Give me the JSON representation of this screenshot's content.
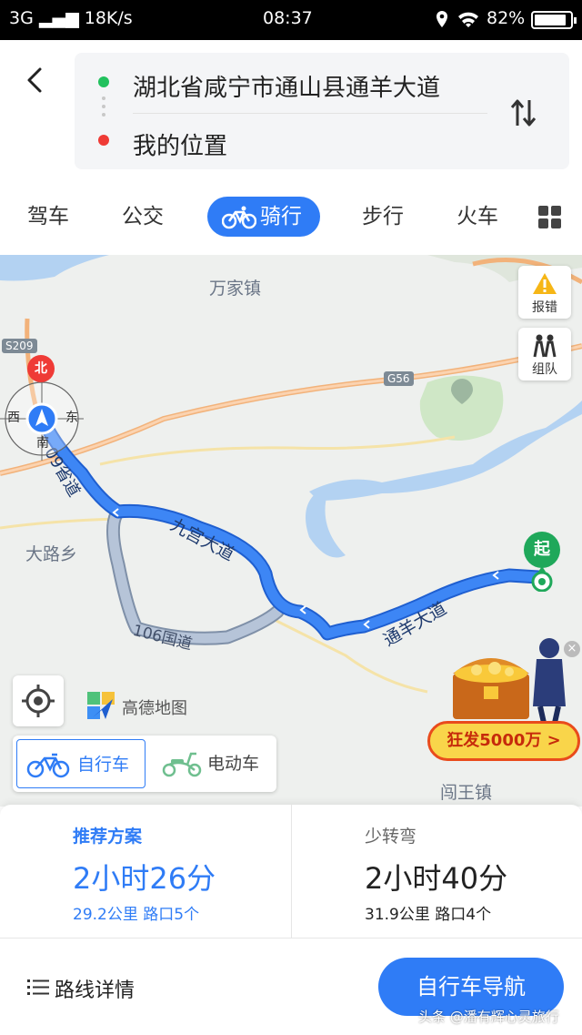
{
  "status_bar": {
    "network": "3G",
    "speed": "18K/s",
    "time": "08:37",
    "battery": "82%"
  },
  "route": {
    "start": "湖北省咸宁市通山县通羊大道",
    "end": "我的位置"
  },
  "modes": [
    {
      "label": "驾车"
    },
    {
      "label": "公交"
    },
    {
      "label": "骑行",
      "active": true
    },
    {
      "label": "步行"
    },
    {
      "label": "火车"
    }
  ],
  "map": {
    "places": [
      "万家镇",
      "大路乡",
      "闯王镇"
    ],
    "road_tags": [
      "S209",
      "G56"
    ],
    "road_labels": [
      "09省道",
      "九宫大道",
      "106国道",
      "通羊大道"
    ],
    "compass": {
      "n": "北",
      "w": "西",
      "e": "东",
      "s": "南"
    },
    "report_label": "报错",
    "team_label": "组队",
    "logo_text": "高德地图",
    "start_pin": "起",
    "promo_label": "狂发5000万 >",
    "vehicles": {
      "bike": "自行车",
      "ebike": "电动车"
    }
  },
  "plans": [
    {
      "tag": "推荐方案",
      "time": "2小时26分",
      "info": "29.2公里 路口5个"
    },
    {
      "tag": "少转弯",
      "time": "2小时40分",
      "info": "31.9公里 路口4个"
    }
  ],
  "actions": {
    "details": "路线详情",
    "navigate": "自行车导航"
  },
  "watermark": "头条 @潘有辉心灵旅行",
  "colors": {
    "accent": "#2f7cf6",
    "start_green": "#22c15e",
    "end_red": "#ef3b36",
    "route_blue": "#3a7ef0",
    "alt_route": "#9fb0c8"
  }
}
